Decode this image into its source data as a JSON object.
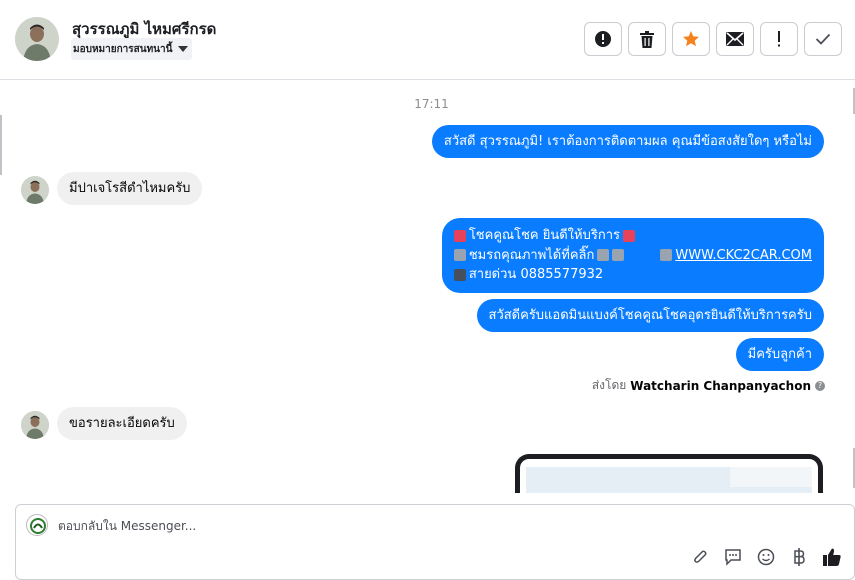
{
  "header": {
    "contact_name": "สุวรรณภูมิ ไหมศรีกรด",
    "assign_label": "มอบหมายการสนทนานี้",
    "actions": [
      {
        "name": "spam-button",
        "icon": "alert-circle-icon"
      },
      {
        "name": "delete-button",
        "icon": "trash-icon"
      },
      {
        "name": "star-button",
        "icon": "star-icon"
      },
      {
        "name": "mark-unread-button",
        "icon": "envelope-icon"
      },
      {
        "name": "follow-up-button",
        "icon": "exclamation-icon"
      },
      {
        "name": "mark-done-button",
        "icon": "check-icon"
      }
    ],
    "star_color": "#f5821f"
  },
  "thread": {
    "timestamp": "17:11",
    "messages": {
      "m1": "สวัสดี สุวรรณภูมิ! เราต้องการติดตามผล คุณมีข้อสงสัยใดๆ หรือไม่",
      "m2": "มีปาเจโรสีดำไหมครับ",
      "m3_line1": "โชคคูณโชค ยินดีให้บริการ",
      "m3_line2": "ชมรถคุณภาพได้ที่คลิ๊ก",
      "m3_link": "WWW.CKC2CAR.COM",
      "m3_line3": "สายด่วน 0885577932",
      "m4": "สวัสดีครับแอดมินแบงค์โชคคูณโชคอุดรยินดีให้บริการครับ",
      "m5": "มีครับลูกค้า",
      "m6": "ขอรายละเอียดครับ"
    },
    "sent_by_prefix": "ส่งโดย",
    "sent_by_name": "Watcharin Chanpanyachon",
    "bubble_color": "#0a7cff"
  },
  "composer": {
    "placeholder": "ตอบกลับใน Messenger...",
    "value": "",
    "tools": [
      "paperclip-icon",
      "chat-bubble-icon",
      "smiley-icon",
      "baht-icon",
      "thumbs-up-icon"
    ]
  }
}
